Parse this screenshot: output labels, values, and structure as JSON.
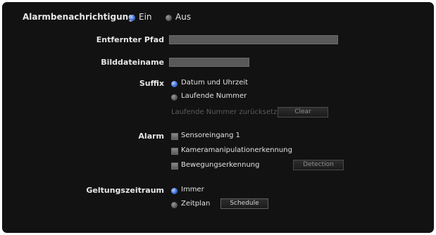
{
  "notification": {
    "label": "Alarmbenachrichtigung",
    "on_label": "Ein",
    "off_label": "Aus",
    "selected": "Ein"
  },
  "remote_path": {
    "label": "Entfernter Pfad",
    "value": ""
  },
  "image_filename": {
    "label": "Bilddateiname",
    "value": ""
  },
  "suffix": {
    "label": "Suffix",
    "options": [
      "Datum und Uhrzeit",
      "Laufende Nummer"
    ],
    "selected": "Datum und Uhrzeit",
    "reset_label": "Laufende Nummer zurücksetzen",
    "clear_button": "Clear"
  },
  "alarm": {
    "label": "Alarm",
    "items": [
      "Sensoreingang 1",
      "Kameramanipulationerkennung",
      "Bewegungserkennung"
    ],
    "detection_button": "Detection"
  },
  "validity": {
    "label": "Geltungszeitraum",
    "options": [
      "Immer",
      "Zeitplan"
    ],
    "selected": "Immer",
    "schedule_button": "Schedule"
  },
  "colors": {
    "accent": "#3f6fd6",
    "panel": "#121212",
    "field": "#595959"
  }
}
